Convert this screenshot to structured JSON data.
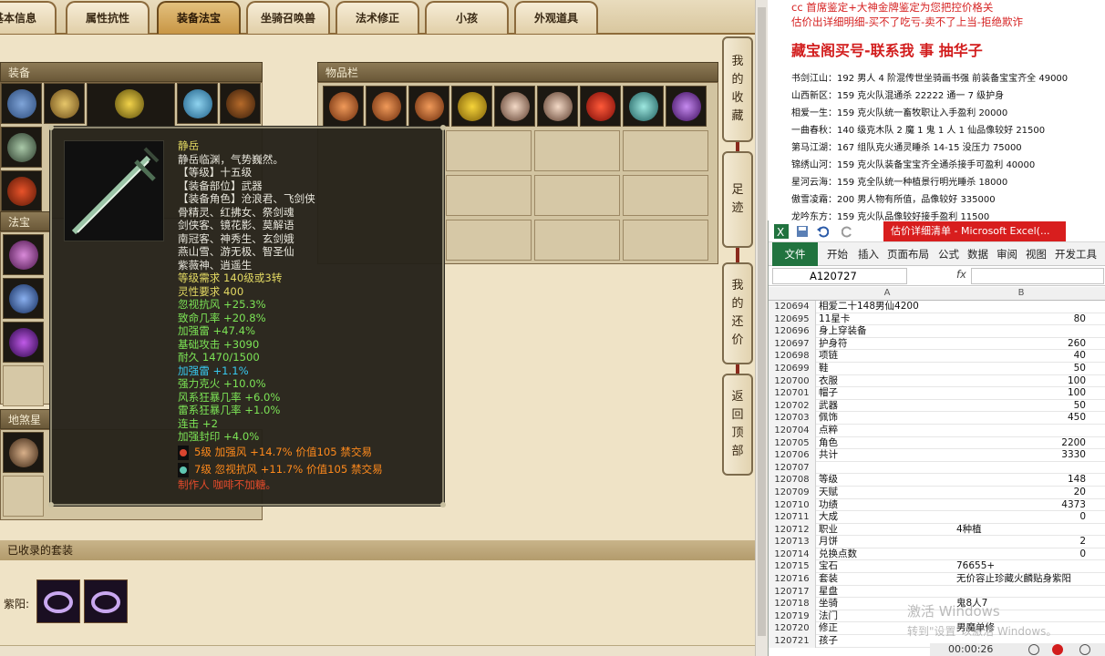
{
  "tabs": [
    "基本信息",
    "属性抗性",
    "装备法宝",
    "坐骑召唤兽",
    "法术修正",
    "小孩",
    "外观道具"
  ],
  "active_tab": "装备法宝",
  "sections": {
    "equipment": "装备",
    "inventory": "物品栏",
    "treasure": "法宝",
    "star": "地煞星",
    "collected_suits": "已收录的套装"
  },
  "side_buttons": [
    {
      "label": "我的收藏",
      "chars": [
        "我",
        "的",
        "收",
        "藏"
      ]
    },
    {
      "label": "足迹",
      "chars": [
        "足",
        "迹"
      ]
    },
    {
      "label": "我的还价",
      "chars": [
        "我",
        "的",
        "还",
        "价"
      ]
    },
    {
      "label": "返回顶部",
      "chars": [
        "返",
        "回",
        "顶",
        "部"
      ]
    }
  ],
  "suit": {
    "label": "紫阳:"
  },
  "tooltip": {
    "name": "静岳",
    "desc": "静岳临渊，气势巍然。",
    "level": "【等级】十五级",
    "part": "【装备部位】武器",
    "roles_title": "【装备角色】沧浪君、飞剑侠",
    "roles": [
      "骨精灵、红拂女、祭剑魂",
      "剑侠客、镜花影、莫解语",
      "南冠客、神秀生、玄剑娥",
      "燕山雪、游无极、智圣仙",
      "紫薇神、逍遥生"
    ],
    "requirement": "等级需求 140级或3转",
    "spirit": "灵性要求 400",
    "stats_green": [
      "忽视抗风 +25.3%",
      "致命几率 +20.8%",
      "加强雷 +47.4%",
      "基础攻击 +3090",
      "耐久 1470/1500"
    ],
    "stats_cyan": [
      "加强雷 +1.1%"
    ],
    "stats_green2": [
      "强力克火 +10.0%",
      "风系狂暴几率 +6.0%",
      "雷系狂暴几率 +1.0%",
      "连击 +2",
      "加强封印 +4.0%"
    ],
    "gems": [
      "5级 加强风 +14.7% 价值105 禁交易",
      "7级 忽视抗风 +11.7% 价值105 禁交易"
    ],
    "maker": "制作人 咖啡不加糖。"
  },
  "notice": {
    "top1": "cc 首席鉴定+大神金牌鉴定为您把控价格关",
    "top2": "估价出详细明细-买不了吃亏-卖不了上当-拒绝欺诈",
    "headline": "藏宝阁买号-联系我 事 抽华子",
    "items": [
      "书剑江山：192 男人 4 阶混传世坐骑画书强 前装备宝宝齐全 49000",
      "山西新区：159 克火队混通杀 22222 通一 7 级护身",
      "相爱一生：159 克火队统一畜牧职让入手盈利 20000",
      "一曲春秋：140 级克木队 2 魔 1 鬼 1 人 1 仙品像较好 21500",
      "第马江湖：167 组队克火通灵睡杀 14-15 没压力 75000",
      "锦绣山河：159 克火队装备宝宝齐全通杀接手可盈利 40000",
      "星河云海：159 克全队统一种植景行明光睡杀 18000",
      "傲雪凌霜：200 男人物有所值，品像较好 335000",
      "龙吟东方：159 克火队品像较好接手盈利 11500"
    ]
  },
  "excel": {
    "title": "估价详细清单 - Microsoft Excel(...",
    "menu": [
      "开始",
      "插入",
      "页面布局",
      "公式",
      "数据",
      "审阅",
      "视图",
      "开发工具"
    ],
    "file": "文件",
    "namebox": "A120727",
    "fx": "fx",
    "col_a": "A",
    "col_b": "B",
    "rows": [
      {
        "n": "120694",
        "a": "相爱二十148男仙4200",
        "b": ""
      },
      {
        "n": "120695",
        "a": "11星卡",
        "b": "80"
      },
      {
        "n": "120696",
        "a": "身上穿装备",
        "b": ""
      },
      {
        "n": "120697",
        "a": "护身符",
        "b": "260"
      },
      {
        "n": "120698",
        "a": "项链",
        "b": "40"
      },
      {
        "n": "120699",
        "a": "鞋",
        "b": "50"
      },
      {
        "n": "120700",
        "a": "衣服",
        "b": "100"
      },
      {
        "n": "120701",
        "a": "帽子",
        "b": "100"
      },
      {
        "n": "120702",
        "a": "武器",
        "b": "50"
      },
      {
        "n": "120703",
        "a": "佩饰",
        "b": "450"
      },
      {
        "n": "120704",
        "a": "点粹",
        "b": ""
      },
      {
        "n": "120705",
        "a": "角色",
        "b": "2200"
      },
      {
        "n": "120706",
        "a": "共计",
        "b": "3330"
      },
      {
        "n": "120707",
        "a": "",
        "b": ""
      },
      {
        "n": "120708",
        "a": "等级",
        "b": "148"
      },
      {
        "n": "120709",
        "a": "天赋",
        "b": "20"
      },
      {
        "n": "120710",
        "a": "功绩",
        "b": "4373"
      },
      {
        "n": "120711",
        "a": "大成",
        "b": "0"
      },
      {
        "n": "120712",
        "a": "职业",
        "b": "4种植",
        "left": true
      },
      {
        "n": "120713",
        "a": "月饼",
        "b": "2"
      },
      {
        "n": "120714",
        "a": "兑换点数",
        "b": "0"
      },
      {
        "n": "120715",
        "a": "宝石",
        "b": "76655+",
        "left": true
      },
      {
        "n": "120716",
        "a": "套装",
        "b": "无价容止珍藏火麟贴身紫阳",
        "left": true
      },
      {
        "n": "120717",
        "a": "星盘",
        "b": ""
      },
      {
        "n": "120718",
        "a": "坐骑",
        "b": "鬼8人7",
        "left": true
      },
      {
        "n": "120719",
        "a": "法门",
        "b": ""
      },
      {
        "n": "120720",
        "a": "修正",
        "b": "男魔单修",
        "left": true
      },
      {
        "n": "120721",
        "a": "孩子",
        "b": ""
      }
    ]
  },
  "watermark": {
    "line1": "激活 Windows",
    "line2": "转到\"设置\"以激活 Windows。"
  },
  "player": {
    "time": "00:00:26"
  },
  "colors": {
    "accent_red": "#d21d1d",
    "excel_green": "#21733f",
    "tooltip_bg": "#242119"
  }
}
